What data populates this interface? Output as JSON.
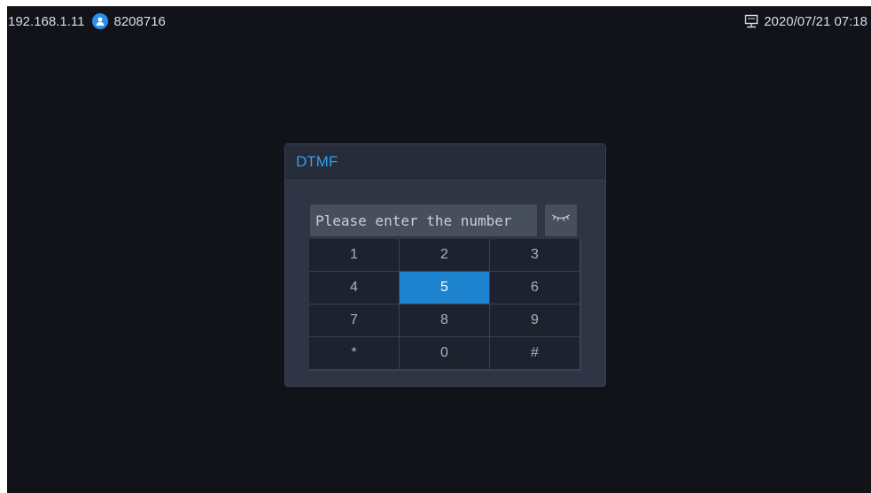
{
  "status_bar": {
    "ip_address": "192.168.1.11",
    "account_icon": "user-icon",
    "account_number": "8208716",
    "network_icon": "network-icon",
    "datetime": "2020/07/21 07:18"
  },
  "dialog": {
    "title": "DTMF",
    "input": {
      "value": "",
      "placeholder": "Please enter the number"
    },
    "visibility_toggle_icon": "eye-closed-icon",
    "keypad": {
      "keys": [
        "1",
        "2",
        "3",
        "4",
        "5",
        "6",
        "7",
        "8",
        "9",
        "*",
        "0",
        "#"
      ],
      "highlighted_key": "5"
    }
  },
  "colors": {
    "accent": "#2e9cf2",
    "highlight": "#1e84cf",
    "background": "#121319",
    "dialog_bg": "#2f3544"
  }
}
